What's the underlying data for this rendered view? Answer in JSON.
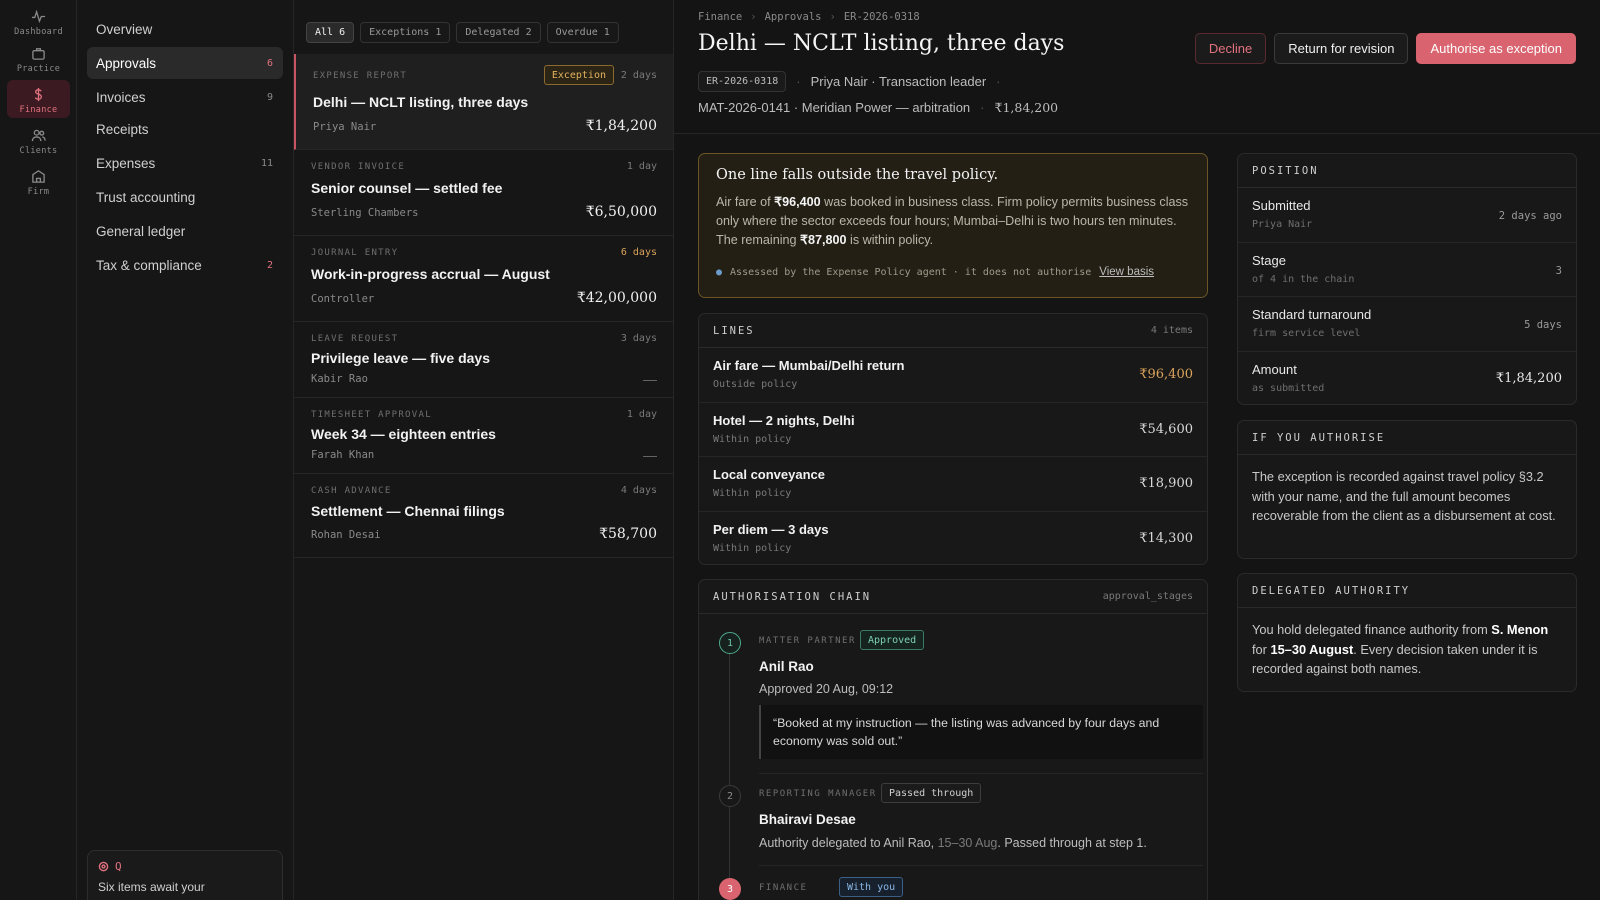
{
  "rail": [
    {
      "label": "Dashboard",
      "icon": "pulse-icon"
    },
    {
      "label": "Practice",
      "icon": "briefcase-icon"
    },
    {
      "label": "Finance",
      "icon": "dollar-icon"
    },
    {
      "label": "Clients",
      "icon": "people-icon"
    },
    {
      "label": "Firm",
      "icon": "building-icon"
    }
  ],
  "subnav": [
    {
      "label": "Overview",
      "count": ""
    },
    {
      "label": "Approvals",
      "count": "6"
    },
    {
      "label": "Invoices",
      "count": "9"
    },
    {
      "label": "Receipts",
      "count": ""
    },
    {
      "label": "Expenses",
      "count": "11"
    },
    {
      "label": "Trust accounting",
      "count": ""
    },
    {
      "label": "General ledger",
      "count": ""
    },
    {
      "label": "Tax & compliance",
      "count": "2"
    }
  ],
  "assistant": {
    "marker": "Q",
    "message": "Six items await your"
  },
  "filters": [
    "All 6",
    "Exceptions 1",
    "Delegated 2",
    "Overdue 1"
  ],
  "queue": [
    {
      "kind": "EXPENSE REPORT",
      "badge": "Exception",
      "age": "2 days",
      "title": "Delhi — NCLT listing, three days",
      "who": "Priya Nair",
      "amount": "₹1,84,200"
    },
    {
      "kind": "VENDOR INVOICE",
      "age": "1 day",
      "title": "Senior counsel — settled fee",
      "who": "Sterling Chambers",
      "amount": "₹6,50,000"
    },
    {
      "kind": "JOURNAL ENTRY",
      "age": "6 days",
      "title": "Work-in-progress accrual — August",
      "who": "Controller",
      "amount": "₹42,00,000"
    },
    {
      "kind": "LEAVE REQUEST",
      "age": "3 days",
      "title": "Privilege leave — five days",
      "who": "Kabir Rao",
      "amount": "—"
    },
    {
      "kind": "TIMESHEET APPROVAL",
      "age": "1 day",
      "title": "Week 34 — eighteen entries",
      "who": "Farah Khan",
      "amount": "—"
    },
    {
      "kind": "CASH ADVANCE",
      "age": "4 days",
      "title": "Settlement — Chennai filings",
      "who": "Rohan Desai",
      "amount": "₹58,700"
    }
  ],
  "detail": {
    "crumbs": [
      "Finance",
      "Approvals",
      "ER-2026-0318"
    ],
    "title": "Delhi — NCLT listing, three days",
    "id": "ER-2026-0318",
    "submitter": "Priya Nair · Transaction leader",
    "matter": "MAT-2026-0141 · Meridian Power — arbitration",
    "amount": "₹1,84,200",
    "actions": {
      "decline": "Decline",
      "return": "Return for revision",
      "authorise": "Authorise as exception"
    }
  },
  "policy": {
    "heading": "One line falls outside the travel policy.",
    "p1": "Air fare of ",
    "air": "₹96,400",
    "p2": " was booked in business class. Firm policy permits business class only where the sector exceeds four hours; Mumbai–Delhi is two hours ten minutes. The remaining ",
    "remaining": "₹87,800",
    "p3": " is within policy.",
    "agent": "Assessed by the Expense Policy agent · it does not authorise",
    "link": "View basis"
  },
  "lines": {
    "title": "LINES",
    "count": "4 items",
    "items": [
      {
        "name": "Air fare — Mumbai/Delhi return",
        "status": "Outside policy",
        "amount": "₹96,400"
      },
      {
        "name": "Hotel — 2 nights, Delhi",
        "status": "Within policy",
        "amount": "₹54,600"
      },
      {
        "name": "Local conveyance",
        "status": "Within policy",
        "amount": "₹18,900"
      },
      {
        "name": "Per diem — 3 days",
        "status": "Within policy",
        "amount": "₹14,300"
      }
    ]
  },
  "chain": {
    "title": "AUTHORISATION CHAIN",
    "ref": "approval_stages",
    "steps": [
      {
        "n": "1",
        "role": "MATTER PARTNER",
        "badge": "Approved",
        "name": "Anil Rao",
        "note": "Approved 20 Aug, 09:12",
        "quote": "“Booked at my instruction — the listing was advanced by four days and economy was sold out.”"
      },
      {
        "n": "2",
        "role": "REPORTING MANAGER",
        "badge": "Passed through",
        "name": "Bhairavi Desae",
        "note_a": "Authority delegated to Anil Rao, ",
        "note_b": "15–30 Aug",
        "note_c": ". Passed through at step 1."
      },
      {
        "n": "3",
        "role": "FINANCE",
        "badge": "With you"
      }
    ]
  },
  "position": {
    "title": "POSITION",
    "rows": [
      {
        "label": "Submitted",
        "sub": "Priya Nair",
        "value": "2 days ago"
      },
      {
        "label": "Stage",
        "sub": "of 4 in the chain",
        "value": "3"
      },
      {
        "label": "Standard turnaround",
        "sub": "firm service level",
        "value": "5 days"
      },
      {
        "label": "Amount",
        "sub": "as submitted",
        "value": "₹1,84,200"
      }
    ]
  },
  "authorise": {
    "title": "IF YOU AUTHORISE",
    "text": "The exception is recorded against travel policy §3.2 with your name, and the full amount becomes recoverable from the client as a disbursement at cost."
  },
  "delegated": {
    "title": "DELEGATED AUTHORITY",
    "t1": "You hold delegated finance authority from ",
    "who": "S. Menon",
    "t2": " for ",
    "period": "15–30 August",
    "t3": ". Every decision taken under it is recorded against both names."
  },
  "colors": {
    "accent": "#d9646f",
    "warning": "#d9a35a",
    "success": "#4fa88e",
    "info": "#6b9bc8"
  }
}
